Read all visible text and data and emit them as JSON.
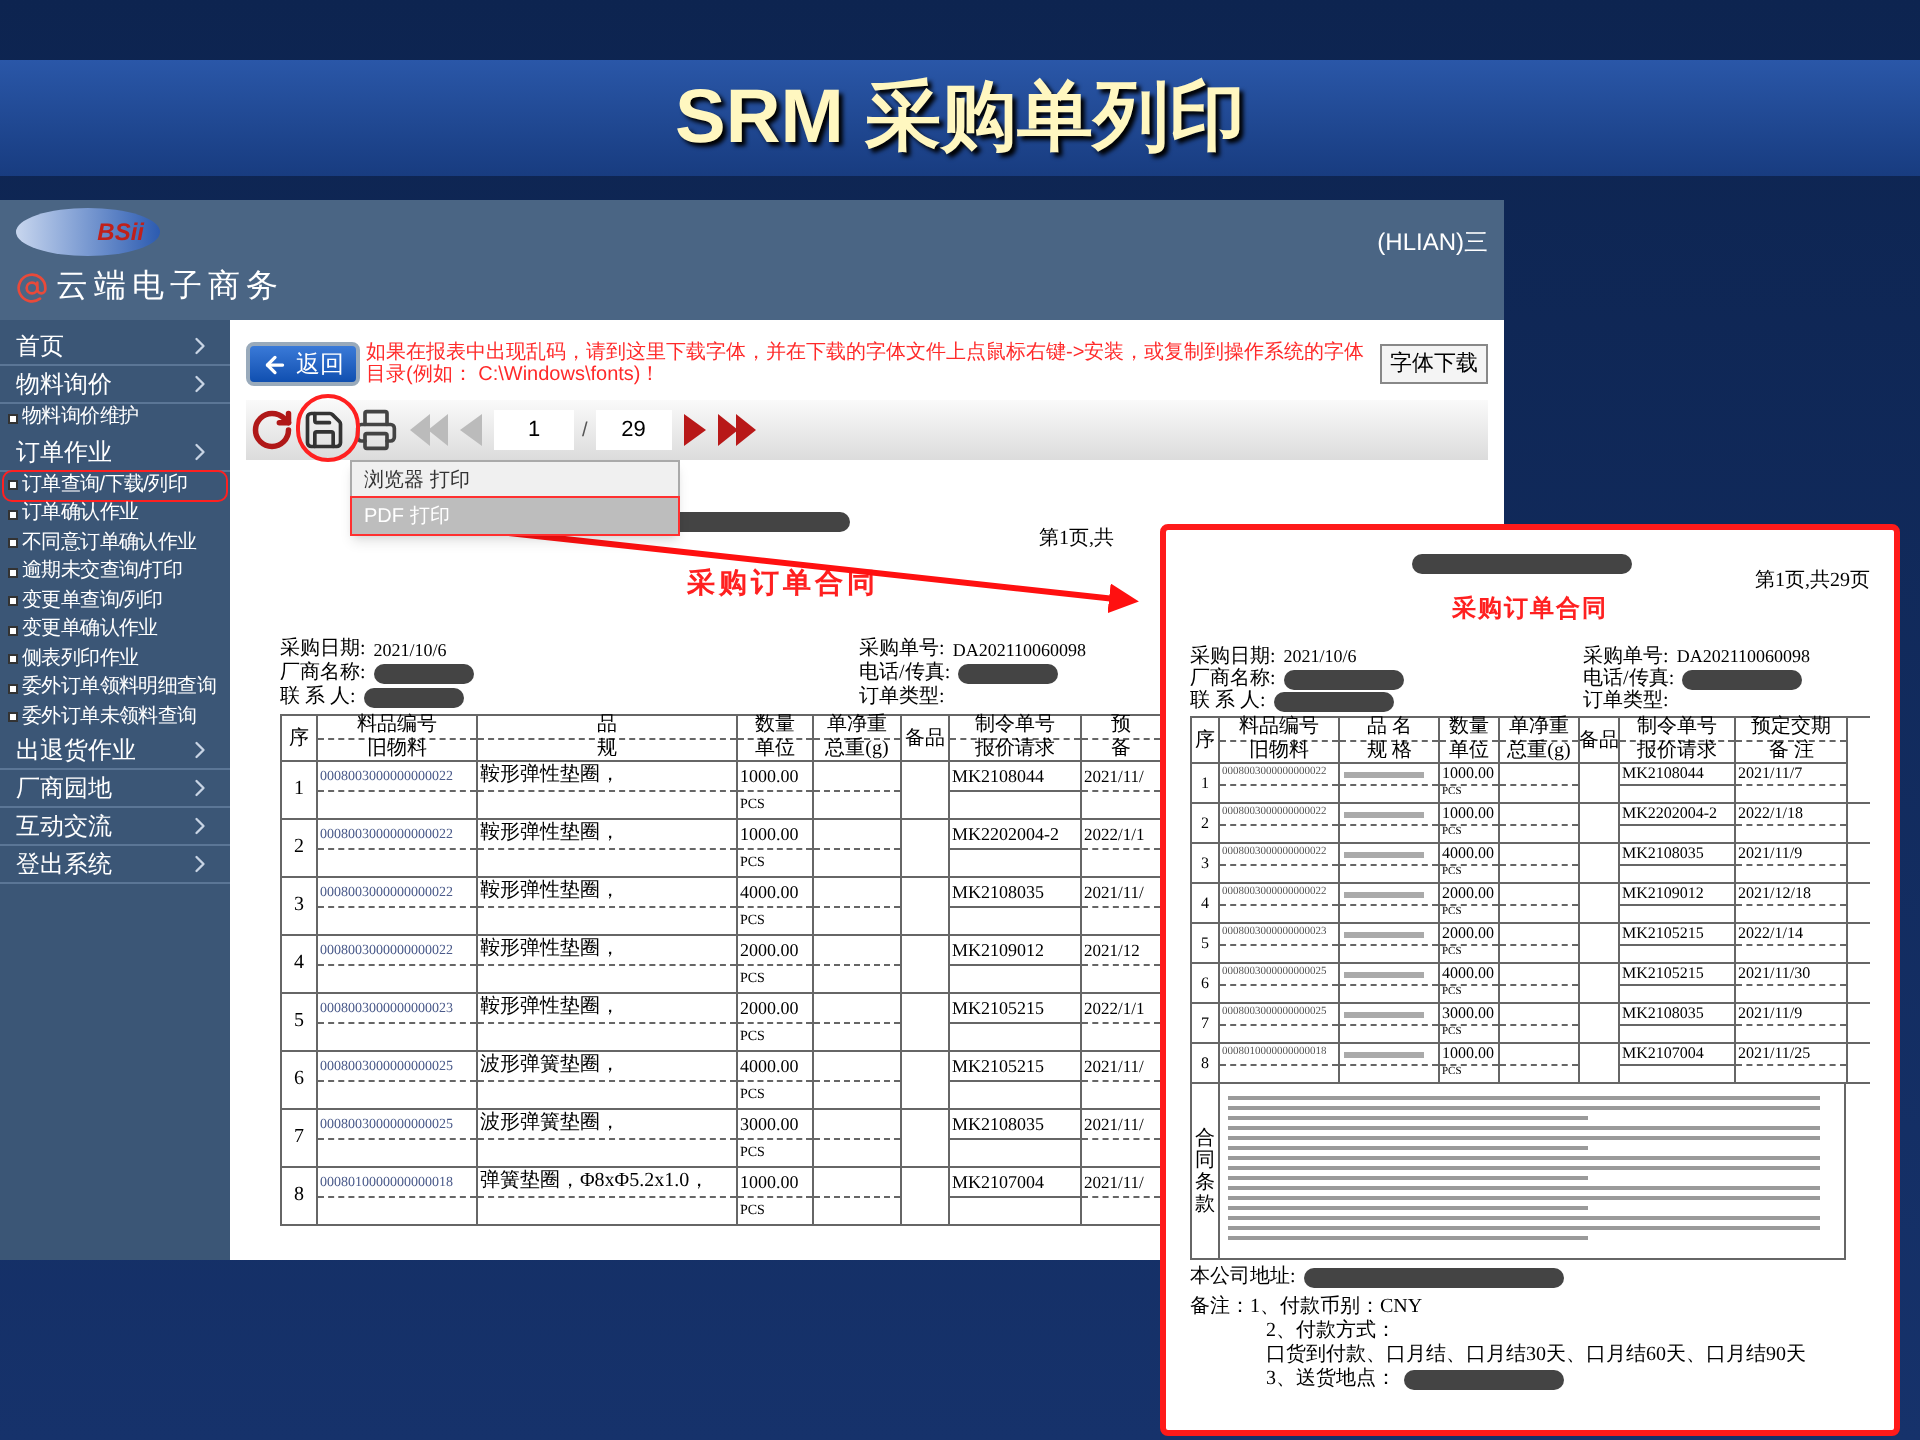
{
  "slide_title": "SRM 采购单列印",
  "app": {
    "logo_text": "BSii",
    "brand": "云端电子商务",
    "user": "(HLIAN)三"
  },
  "sidebar": [
    {
      "label": "首页"
    },
    {
      "label": "物料询价",
      "children": [
        {
          "label": "物料询价维护",
          "selected": false
        }
      ]
    },
    {
      "label": "订单作业",
      "children": [
        {
          "label": "订单查询/下载/列印",
          "selected": true
        },
        {
          "label": "订单确认作业",
          "selected": false
        },
        {
          "label": "不同意订单确认作业",
          "selected": false
        },
        {
          "label": "逾期未交查询/打印",
          "selected": false
        },
        {
          "label": "变更单查询/列印",
          "selected": false
        },
        {
          "label": "变更单确认作业",
          "selected": false
        },
        {
          "label": "侧表列印作业",
          "selected": false
        },
        {
          "label": "委外订单领料明细查询",
          "selected": false
        },
        {
          "label": "委外订单未领料查询",
          "selected": false
        }
      ]
    },
    {
      "label": "出退货作业"
    },
    {
      "label": "厂商园地"
    },
    {
      "label": "互动交流"
    },
    {
      "label": "登出系统"
    }
  ],
  "toolbar": {
    "back_button": "返回",
    "notice": "如果在报表中出现乱码，请到这里下载字体，并在下载的字体文件上点鼠标右键->安装，或复制到操作系统的字体目录(例如： C:\\Windows\\fonts)！",
    "font_button": "字体下载",
    "page_input": "1",
    "page_separator": "/",
    "page_total": "29",
    "print_menu": [
      {
        "label": "浏览器 打印",
        "selected": false
      },
      {
        "label": "PDF 打印",
        "selected": true
      }
    ]
  },
  "document": {
    "page_info": "第1页,共",
    "title": "采购订单合同",
    "fields_left": [
      {
        "label": "采购日期:",
        "value": "2021/10/6",
        "redacted": false
      },
      {
        "label": "厂商名称:",
        "redacted": true
      },
      {
        "label": "联 系 人:",
        "redacted": true
      }
    ],
    "fields_right": [
      {
        "label": "采购单号:",
        "value": "DA202110060098",
        "redacted": false
      },
      {
        "label": "电话/传真:",
        "redacted": true
      },
      {
        "label": "订单类型:",
        "redacted": false
      }
    ],
    "columns": [
      {
        "top": "序"
      },
      {
        "top": "料品编号",
        "bottom": "旧物料"
      },
      {
        "top": "品",
        "bottom": "规"
      },
      {
        "top": "数量",
        "bottom": "单位"
      },
      {
        "top": "单净重",
        "bottom": "总重(g)"
      },
      {
        "top": "备品"
      },
      {
        "top": "制令单号",
        "bottom": "报价请求"
      },
      {
        "top": "预",
        "bottom": "备"
      }
    ],
    "rows": [
      {
        "no": "1",
        "code": "0008003000000000022",
        "name": "鞍形弹性垫圈，",
        "qty": "1000.00",
        "unit": "PCS",
        "order_no": "MK2108044",
        "date": "2021/11/"
      },
      {
        "no": "2",
        "code": "0008003000000000022",
        "name": "鞍形弹性垫圈，",
        "qty": "1000.00",
        "unit": "PCS",
        "order_no": "MK2202004-2",
        "date": "2022/1/1"
      },
      {
        "no": "3",
        "code": "0008003000000000022",
        "name": "鞍形弹性垫圈，",
        "qty": "4000.00",
        "unit": "PCS",
        "order_no": "MK2108035",
        "date": "2021/11/"
      },
      {
        "no": "4",
        "code": "0008003000000000022",
        "name": "鞍形弹性垫圈，",
        "qty": "2000.00",
        "unit": "PCS",
        "order_no": "MK2109012",
        "date": "2021/12"
      },
      {
        "no": "5",
        "code": "0008003000000000023",
        "name": "鞍形弹性垫圈，",
        "qty": "2000.00",
        "unit": "PCS",
        "order_no": "MK2105215",
        "date": "2022/1/1"
      },
      {
        "no": "6",
        "code": "0008003000000000025",
        "name": "波形弹簧垫圈，",
        "qty": "4000.00",
        "unit": "PCS",
        "order_no": "MK2105215",
        "date": "2021/11/"
      },
      {
        "no": "7",
        "code": "0008003000000000025",
        "name": "波形弹簧垫圈，",
        "qty": "3000.00",
        "unit": "PCS",
        "order_no": "MK2108035",
        "date": "2021/11/"
      },
      {
        "no": "8",
        "code": "0008010000000000018",
        "name": "弹簧垫圈，Φ8xΦ5.2x1.0，",
        "qty": "1000.00",
        "unit": "PCS",
        "order_no": "MK2107004",
        "date": "2021/11/"
      }
    ]
  },
  "preview": {
    "page_info": "第1页,共29页",
    "title": "采购订单合同",
    "fields_left": [
      {
        "label": "采购日期:",
        "value": "2021/10/6",
        "redacted": false
      },
      {
        "label": "厂商名称:",
        "redacted": true
      },
      {
        "label": "联 系 人:",
        "redacted": true
      }
    ],
    "fields_right": [
      {
        "label": "采购单号:",
        "value": "DA202110060098",
        "redacted": false
      },
      {
        "label": "电话/传真:",
        "redacted": true
      },
      {
        "label": "订单类型:",
        "redacted": false
      }
    ],
    "columns": [
      {
        "top": "序"
      },
      {
        "top": "料品编号",
        "bottom": "旧物料"
      },
      {
        "top": "品 名",
        "bottom": "规 格"
      },
      {
        "top": "数量",
        "bottom": "单位"
      },
      {
        "top": "单净重",
        "bottom": "总重(g)"
      },
      {
        "top": "备品"
      },
      {
        "top": "制令单号",
        "bottom": "报价请求"
      },
      {
        "top": "预定交期",
        "bottom": "备 注"
      }
    ],
    "rows": [
      {
        "no": "1",
        "code": "0008003000000000022",
        "qty": "1000.00",
        "unit": "PCS",
        "order_no": "MK2108044",
        "date": "2021/11/7"
      },
      {
        "no": "2",
        "code": "0008003000000000022",
        "qty": "1000.00",
        "unit": "PCS",
        "order_no": "MK2202004-2",
        "date": "2022/1/18"
      },
      {
        "no": "3",
        "code": "0008003000000000022",
        "qty": "4000.00",
        "unit": "PCS",
        "order_no": "MK2108035",
        "date": "2021/11/9"
      },
      {
        "no": "4",
        "code": "0008003000000000022",
        "qty": "2000.00",
        "unit": "PCS",
        "order_no": "MK2109012",
        "date": "2021/12/18"
      },
      {
        "no": "5",
        "code": "0008003000000000023",
        "qty": "2000.00",
        "unit": "PCS",
        "order_no": "MK2105215",
        "date": "2022/1/14"
      },
      {
        "no": "6",
        "code": "0008003000000000025",
        "qty": "4000.00",
        "unit": "PCS",
        "order_no": "MK2105215",
        "date": "2021/11/30"
      },
      {
        "no": "7",
        "code": "0008003000000000025",
        "qty": "3000.00",
        "unit": "PCS",
        "order_no": "MK2108035",
        "date": "2021/11/9"
      },
      {
        "no": "8",
        "code": "0008010000000000018",
        "qty": "1000.00",
        "unit": "PCS",
        "order_no": "MK2107004",
        "date": "2021/11/25"
      }
    ],
    "clauses_label": "合同条款",
    "address_label": "本公司地址:",
    "notes": [
      {
        "text": "备注：1、付款币别：CNY",
        "redacted": false
      },
      {
        "text": "2、付款方式：",
        "redacted": false
      },
      {
        "text": "口货到付款、口月结、口月结30天、口月结60天、口月结90天",
        "redacted": false
      },
      {
        "text": "3、送货地点：",
        "redacted": true
      }
    ]
  }
}
